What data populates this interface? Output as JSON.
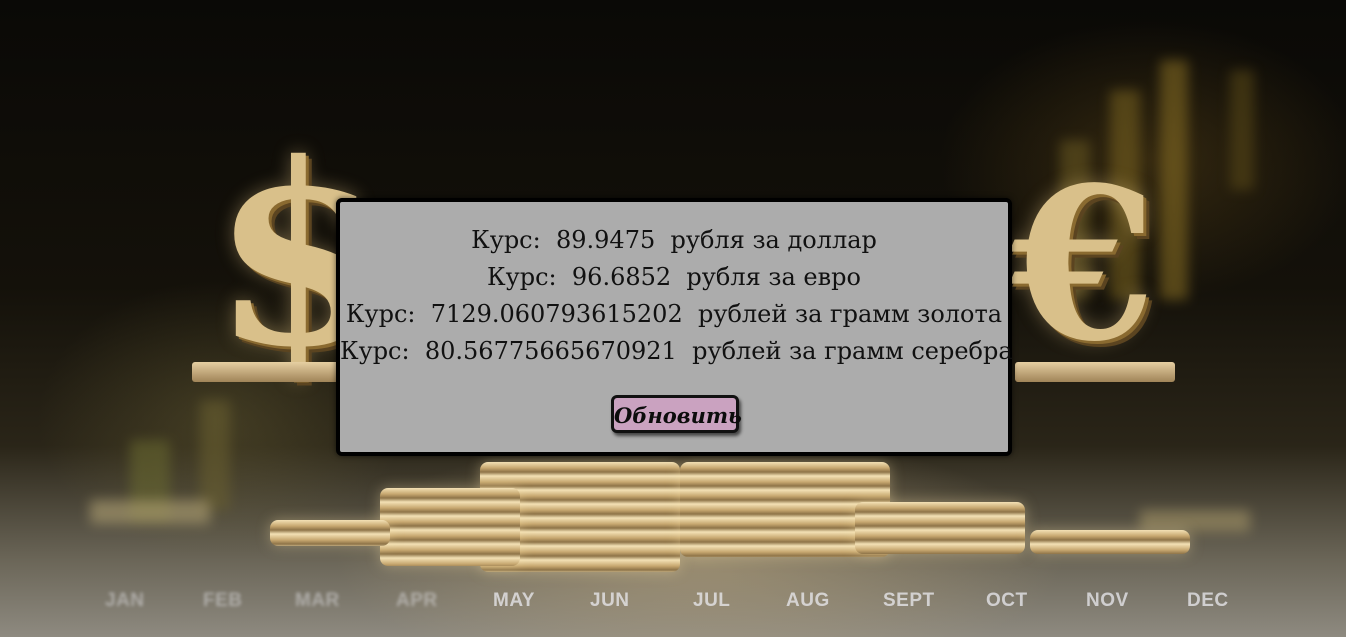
{
  "rates": [
    {
      "prefix": "Курс:",
      "value": "89.9475",
      "suffix": "рубля за доллар"
    },
    {
      "prefix": "Курс:",
      "value": "96.6852",
      "suffix": "рубля за евро"
    },
    {
      "prefix": "Курс:",
      "value": "7129.060793615202",
      "suffix": "рублей за грамм золота"
    },
    {
      "prefix": "Курс:",
      "value": "80.56775665670921",
      "suffix": "рублей за грамм серебра"
    }
  ],
  "refresh_button_label": "Обновить",
  "background": {
    "months": [
      "JAN",
      "FEB",
      "MAR",
      "APR",
      "MAY",
      "JUN",
      "JUL",
      "AUG",
      "SEPT",
      "OCT",
      "NOV",
      "DEC"
    ],
    "icons": [
      "dollar-sign-icon",
      "euro-sign-icon",
      "gold-coins"
    ]
  },
  "colors": {
    "panel_background": "#acacac",
    "button_background": "#caa2c0",
    "border": "#000000"
  }
}
